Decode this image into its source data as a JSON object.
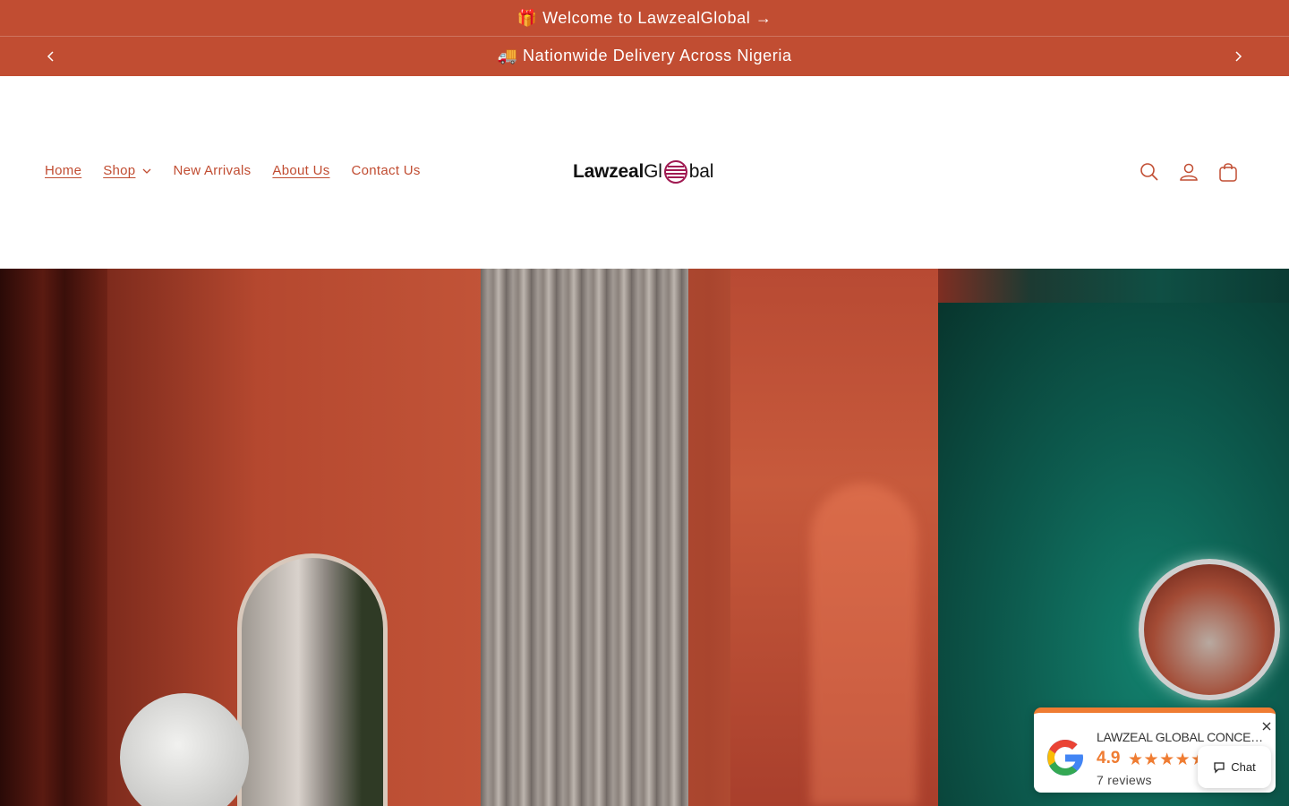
{
  "announcements": {
    "welcome": "🎁 Welcome to LawzealGlobal →",
    "delivery": "🚚 Nationwide Delivery Across Nigeria"
  },
  "nav": {
    "home": "Home",
    "shop": "Shop",
    "new_arrivals": "New Arrivals",
    "about": "About Us",
    "contact": "Contact Us"
  },
  "logo": {
    "part1": "Lawzeal",
    "part2": "Gl",
    "part3": "bal"
  },
  "review_widget": {
    "business_name": "LAWZEAL GLOBAL CONCEPTS",
    "rating": "4.9",
    "stars": "★★★★★",
    "reviews": "7 reviews"
  },
  "chat": {
    "label": "Chat"
  },
  "colors": {
    "brand": "#c14d32",
    "rating": "#ef7c32"
  }
}
